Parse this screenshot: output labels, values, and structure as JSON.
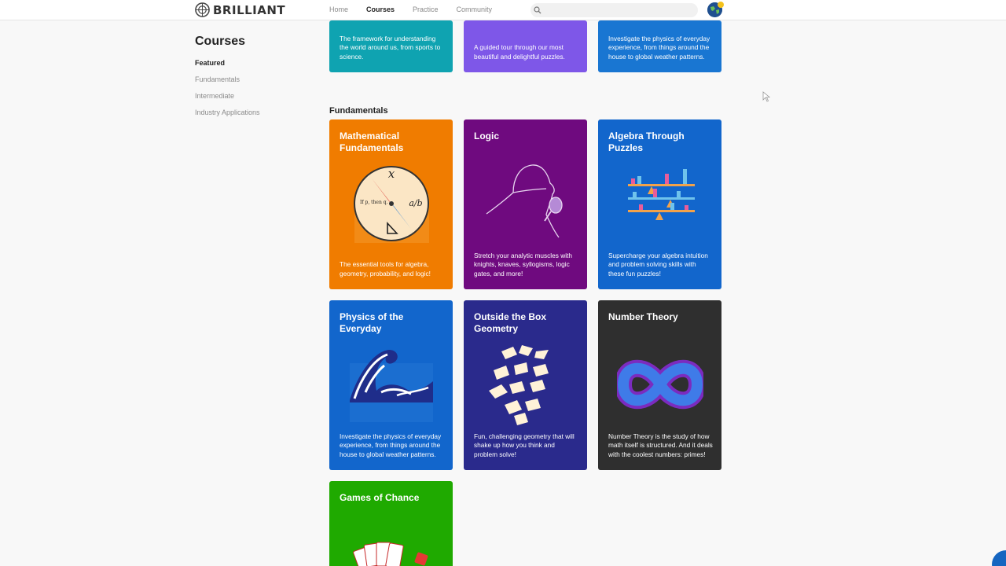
{
  "header": {
    "logo": "BRILLIANT",
    "nav": [
      "Home",
      "Courses",
      "Practice",
      "Community"
    ],
    "active_nav": "Courses",
    "search_placeholder": "",
    "icons": [
      "brilliant-logo-icon",
      "search-icon",
      "avatar-globe-icon"
    ]
  },
  "sidebar": {
    "title": "Courses",
    "items": [
      "Featured",
      "Fundamentals",
      "Intermediate",
      "Industry Applications"
    ],
    "active": "Featured"
  },
  "featured_partial": [
    {
      "desc": "The framework for understanding the world around us, from sports to science.",
      "color": "#0fa3b1"
    },
    {
      "desc": "A guided tour through our most beautiful and delightful puzzles.",
      "color": "#7e57e8"
    },
    {
      "desc": "Investigate the physics of everyday experience, from things around the house to global weather patterns.",
      "color": "#1976d2"
    }
  ],
  "section": {
    "title": "Fundamentals"
  },
  "courses": [
    {
      "title": "Mathematical Fundamentals",
      "desc": "The essential tools for algebra, geometry, probability, and logic!",
      "color": "#f07c00",
      "art_label_x": "x",
      "art_label_ab": "a/b",
      "art_label_if": "If p, then q."
    },
    {
      "title": "Logic",
      "desc": "Stretch your analytic muscles with knights, knaves, syllogisms, logic gates, and more!",
      "color": "#6f0a7f"
    },
    {
      "title": "Algebra Through Puzzles",
      "desc": "Supercharge your algebra intuition and problem solving skills with these fun puzzles!",
      "color": "#1266cc"
    },
    {
      "title": "Physics of the Everyday",
      "desc": "Investigate the physics of everyday experience, from things around the house to global weather patterns.",
      "color": "#1266cc"
    },
    {
      "title": "Outside the Box Geometry",
      "desc": "Fun, challenging geometry that will shake up how you think and problem solve!",
      "color": "#2a2a8c"
    },
    {
      "title": "Number Theory",
      "desc": "Number Theory is the study of how math itself is structured. And it deals with the coolest numbers: primes!",
      "color": "#2f2f2f"
    },
    {
      "title": "Games of Chance",
      "desc": "",
      "color": "#1faa00"
    }
  ]
}
